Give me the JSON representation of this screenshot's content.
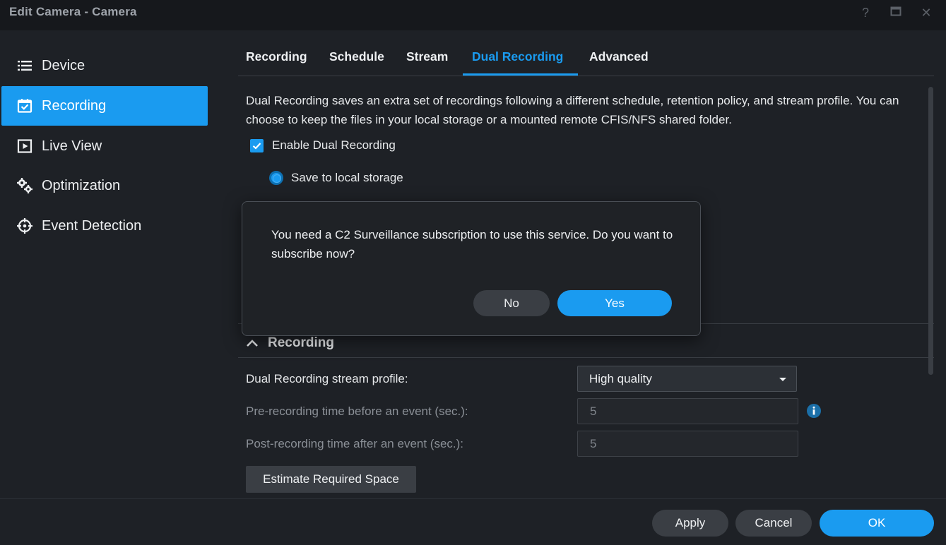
{
  "window": {
    "title": "Edit Camera - Camera",
    "help_icon": "?",
    "maximize_icon": "▭",
    "close_icon": "✕"
  },
  "sidebar": {
    "items": [
      {
        "label": "Device",
        "icon": "list-icon",
        "active": false
      },
      {
        "label": "Recording",
        "icon": "calendar-check-icon",
        "active": true
      },
      {
        "label": "Live View",
        "icon": "play-square-icon",
        "active": false
      },
      {
        "label": "Optimization",
        "icon": "gears-icon",
        "active": false
      },
      {
        "label": "Event Detection",
        "icon": "crosshair-icon",
        "active": false
      }
    ]
  },
  "tabs": [
    {
      "label": "Recording",
      "active": false
    },
    {
      "label": "Schedule",
      "active": false
    },
    {
      "label": "Stream",
      "active": false
    },
    {
      "label": "Dual Recording",
      "active": true
    },
    {
      "label": "Advanced",
      "active": false
    }
  ],
  "content": {
    "description": "Dual Recording saves an extra set of recordings following a different schedule, retention policy, and stream profile. You can choose to keep the files in your local storage or a mounted remote CFIS/NFS shared folder.",
    "enable_checkbox": {
      "label": "Enable Dual Recording",
      "checked": true
    },
    "save_local_radio": {
      "label": "Save to local storage",
      "selected": true
    },
    "section_title": "Recording",
    "stream_profile": {
      "label": "Dual Recording stream profile:",
      "value": "High quality"
    },
    "pre_recording": {
      "label": "Pre-recording time before an event (sec.):",
      "value": "5"
    },
    "post_recording": {
      "label": "Post-recording time after an event (sec.):",
      "value": "5"
    },
    "estimate_button": "Estimate Required Space"
  },
  "footer": {
    "apply": "Apply",
    "cancel": "Cancel",
    "ok": "OK"
  },
  "modal": {
    "message": "You need a C2 Surveillance subscription to use this service. Do you want to subscribe now?",
    "no": "No",
    "yes": "Yes"
  },
  "colors": {
    "accent": "#1a9bf0",
    "background": "#1e2126",
    "titlebar": "#16181c"
  }
}
